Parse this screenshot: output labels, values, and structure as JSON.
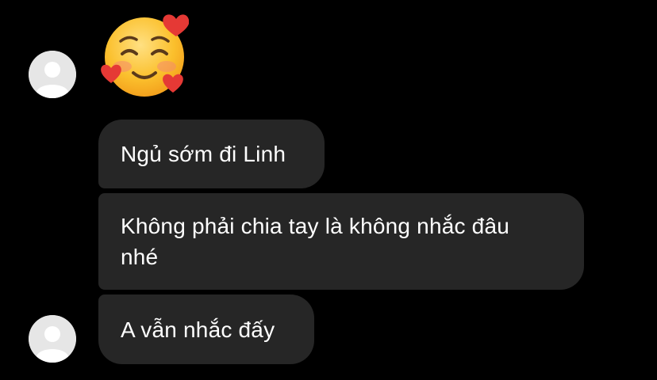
{
  "thread": {
    "emoji": {
      "name": "smiling-face-with-hearts-emoji",
      "face_color": "#FBC02D",
      "heart_color": "#E53935"
    },
    "messages": [
      {
        "text": "Ngủ sớm đi Linh"
      },
      {
        "text": "Không phải chia tay là không nhắc đâu nhé"
      },
      {
        "text": "A vẫn nhắc đấy"
      }
    ]
  },
  "colors": {
    "background": "#000000",
    "bubble": "#262626",
    "text": "#FFFFFF",
    "avatar": "#E6E6E6"
  }
}
